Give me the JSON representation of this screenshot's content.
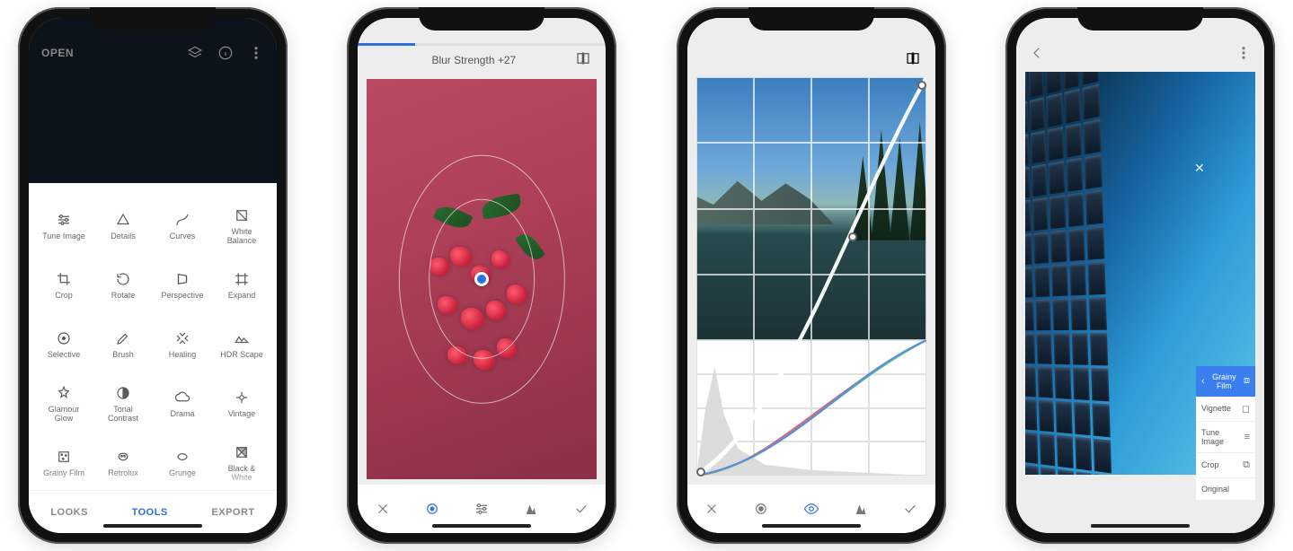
{
  "phone1": {
    "open_label": "OPEN",
    "tools": [
      {
        "label": "Tune Image",
        "icon": "tune-icon"
      },
      {
        "label": "Details",
        "icon": "details-icon"
      },
      {
        "label": "Curves",
        "icon": "curves-icon"
      },
      {
        "label": "White Balance",
        "icon": "white-balance-icon"
      },
      {
        "label": "Crop",
        "icon": "crop-icon"
      },
      {
        "label": "Rotate",
        "icon": "rotate-icon"
      },
      {
        "label": "Perspective",
        "icon": "perspective-icon"
      },
      {
        "label": "Expand",
        "icon": "expand-icon"
      },
      {
        "label": "Selective",
        "icon": "selective-icon"
      },
      {
        "label": "Brush",
        "icon": "brush-icon"
      },
      {
        "label": "Healing",
        "icon": "healing-icon"
      },
      {
        "label": "HDR Scape",
        "icon": "hdr-scape-icon"
      },
      {
        "label": "Glamour Glow",
        "icon": "glamour-glow-icon"
      },
      {
        "label": "Tonal Contrast",
        "icon": "tonal-contrast-icon"
      },
      {
        "label": "Drama",
        "icon": "drama-icon"
      },
      {
        "label": "Vintage",
        "icon": "vintage-icon"
      },
      {
        "label": "Grainy Film",
        "icon": "grainy-film-icon"
      },
      {
        "label": "Retrolux",
        "icon": "retrolux-icon"
      },
      {
        "label": "Grunge",
        "icon": "grunge-icon"
      },
      {
        "label": "Black & White",
        "icon": "black-white-icon"
      }
    ],
    "tabs": {
      "looks": "LOOKS",
      "tools": "TOOLS",
      "export": "EXPORT",
      "active": "tools"
    }
  },
  "phone2": {
    "title": "Blur Strength +27",
    "progress_percent": 23
  },
  "phone4": {
    "steps": [
      {
        "label": "Grainy Film",
        "active": true
      },
      {
        "label": "Vignette",
        "active": false
      },
      {
        "label": "Tune Image",
        "active": false
      },
      {
        "label": "Crop",
        "active": false
      },
      {
        "label": "Original",
        "active": false
      }
    ]
  }
}
